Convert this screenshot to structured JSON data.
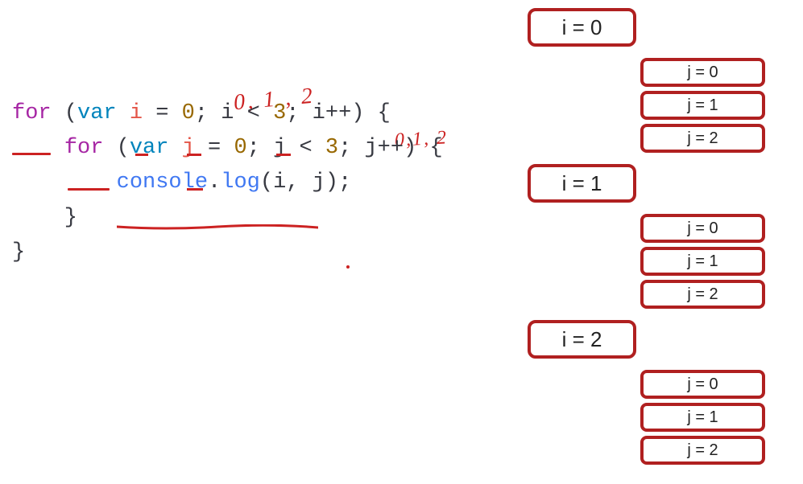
{
  "annotations": {
    "hand1": "0, 1 , 2",
    "hand2": "0,1, 2"
  },
  "code": {
    "line1": {
      "for": "for",
      "open": " (",
      "var": "var",
      "sp1": " ",
      "i": "i",
      "eq": " = ",
      "zero": "0",
      "semi1": "; ",
      "cond_i": "i",
      "lt": " < ",
      "three": "3",
      "semi2": "; ",
      "inc": "i++",
      "close": ") {"
    },
    "line2": {
      "indent": "    ",
      "for": "for",
      "open": " (",
      "var": "var",
      "sp1": " ",
      "j": "j",
      "eq": " = ",
      "zero": "0",
      "semi1": "; ",
      "cond_j": "j",
      "lt": " < ",
      "three": "3",
      "semi2": "; ",
      "inc": "j++",
      "close": ") {"
    },
    "line3": {
      "indent": "        ",
      "console": "console",
      "dot": ".",
      "log": "log",
      "open": "(",
      "arg1": "i",
      "comma": ", ",
      "arg2": "j",
      "close": ");"
    },
    "line4": "    }",
    "line5": "}"
  },
  "iterations": [
    {
      "outer": "i = 0",
      "inner": [
        "j = 0",
        "j = 1",
        "j = 2"
      ]
    },
    {
      "outer": "i = 1",
      "inner": [
        "j = 0",
        "j = 1",
        "j = 2"
      ]
    },
    {
      "outer": "i = 2",
      "inner": [
        "j = 0",
        "j = 1",
        "j = 2"
      ]
    }
  ],
  "colors": {
    "accent_red": "#b02020",
    "annotation_red": "#cc2222",
    "keyword_purple": "#a626a4",
    "keyword_blue": "#0184bc",
    "ident_orange": "#e45649",
    "number_olive": "#986801",
    "builtin_blue": "#4078f2"
  }
}
